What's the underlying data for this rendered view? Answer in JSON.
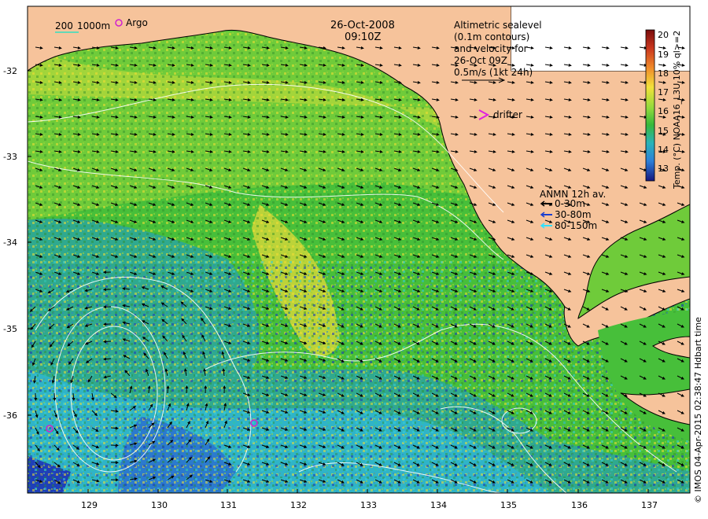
{
  "map": {
    "date": "26-Oct-2008",
    "time": "09:10Z",
    "scale_bar": {
      "isobath_1": "200",
      "isobath_2": "1000m"
    },
    "argo_label": "Argo",
    "drifter_label": "drifter",
    "altimetry_text": [
      "Altimetric sealevel",
      "(0.1m contours)",
      "and velocity for",
      "26-Oct 09Z",
      "0.5m/s (1kt 24h)"
    ],
    "anmn": {
      "title": "ANMN 12h av.",
      "items": [
        {
          "label": "0-30m",
          "color": "#000000"
        },
        {
          "label": "30-80m",
          "color": "#1a3fd0"
        },
        {
          "label": "80-150m",
          "color": "#33e0ff"
        }
      ]
    },
    "colorbar": {
      "label": "Temp. (°C) NOAA16_L3U 10% ql>=2",
      "ticks": [
        "20",
        "19",
        "18",
        "17",
        "16",
        "15",
        "14",
        "13"
      ],
      "min": 12.5,
      "max": 20.3
    },
    "lat_ticks": [
      "-32",
      "-33",
      "-34",
      "-35",
      "-36"
    ],
    "lon_ticks": [
      "129",
      "130",
      "131",
      "132",
      "133",
      "134",
      "135",
      "136",
      "137"
    ],
    "credit": "© IMOS 04-Apr-2015 02:38:47 Hdbart time",
    "colors": {
      "land": "#f6c39b",
      "ocean_warm": "#f2e23a",
      "ocean_mid": "#46c23a",
      "ocean_cool": "#2aa9c9",
      "ocean_cold": "#1f3fb8"
    }
  }
}
